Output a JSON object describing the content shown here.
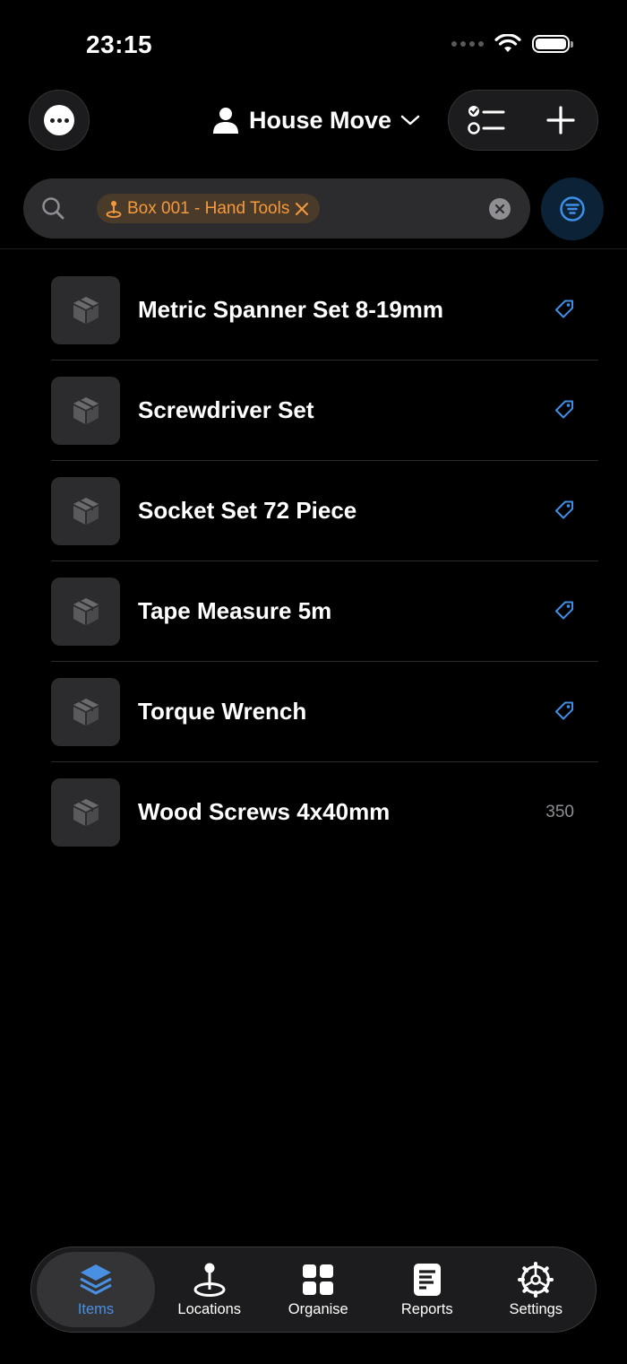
{
  "status_bar": {
    "time": "23:15"
  },
  "header": {
    "title": "House Move",
    "more_icon": "ellipsis-circle-icon",
    "profile_icon": "person-icon",
    "checklist_icon": "checklist-icon",
    "add_icon": "plus-icon"
  },
  "search": {
    "token_label": "Box 001 - Hand Tools",
    "token_icon": "location-pin-icon",
    "token_color": "#F59A3C"
  },
  "items": [
    {
      "name": "Metric Spanner Set 8-19mm",
      "accessory": "tag"
    },
    {
      "name": "Screwdriver Set",
      "accessory": "tag"
    },
    {
      "name": "Socket Set 72 Piece",
      "accessory": "tag"
    },
    {
      "name": "Tape Measure 5m",
      "accessory": "tag"
    },
    {
      "name": "Torque Wrench",
      "accessory": "tag"
    },
    {
      "name": "Wood Screws 4x40mm",
      "accessory": "count",
      "count": "350"
    }
  ],
  "tab_bar": {
    "tabs": [
      {
        "label": "Items",
        "icon": "stack-icon",
        "active": true
      },
      {
        "label": "Locations",
        "icon": "location-pin-icon"
      },
      {
        "label": "Organise",
        "icon": "grid-icon"
      },
      {
        "label": "Reports",
        "icon": "report-document-icon"
      },
      {
        "label": "Settings",
        "icon": "gear-icon"
      }
    ]
  },
  "colors": {
    "accent": "#4A90E2",
    "tag_blue": "#3D8FE8",
    "background": "#000000"
  }
}
